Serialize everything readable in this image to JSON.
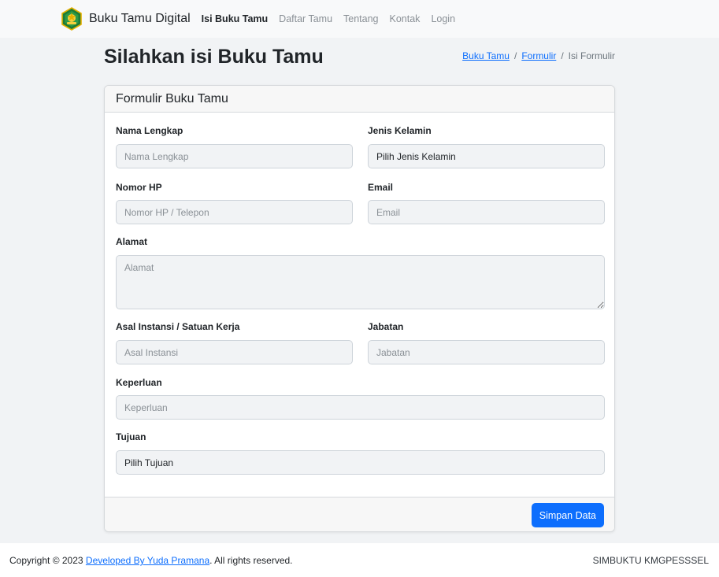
{
  "navbar": {
    "brand": "Buku Tamu Digital",
    "links": [
      "Isi Buku Tamu",
      "Daftar Tamu",
      "Tentang",
      "Kontak",
      "Login"
    ]
  },
  "page": {
    "title_prefix": "Silahkan isi ",
    "title_bold": "Buku Tamu"
  },
  "breadcrumb": {
    "items": [
      "Buku Tamu",
      "Formulir",
      "Isi Formulir"
    ],
    "separator": "/"
  },
  "form": {
    "header": "Formulir Buku Tamu",
    "nama": {
      "label": "Nama Lengkap",
      "placeholder": "Nama Lengkap",
      "value": ""
    },
    "jenis_kelamin": {
      "label": "Jenis Kelamin",
      "selected": "Pilih Jenis Kelamin"
    },
    "nomor_hp": {
      "label": "Nomor HP",
      "placeholder": "Nomor HP / Telepon",
      "value": ""
    },
    "email": {
      "label": "Email",
      "placeholder": "Email",
      "value": ""
    },
    "alamat": {
      "label": "Alamat",
      "placeholder": "Alamat",
      "value": ""
    },
    "instansi": {
      "label": "Asal Instansi / Satuan Kerja",
      "placeholder": "Asal Instansi",
      "value": ""
    },
    "jabatan": {
      "label": "Jabatan",
      "placeholder": "Jabatan",
      "value": ""
    },
    "keperluan": {
      "label": "Keperluan",
      "placeholder": "Keperluan",
      "value": ""
    },
    "tujuan": {
      "label": "Tujuan",
      "selected": "Pilih Tujuan"
    },
    "submit_label": "Simpan Data"
  },
  "footer": {
    "copyright_prefix": "Copyright © 2023 ",
    "developer_link": "Developed By Yuda Pramana",
    "copyright_suffix": ". All rights reserved.",
    "right_text": "SIMBUKTU KMGPESSSEL"
  },
  "colors": {
    "primary": "#0d6efd",
    "navbar_bg": "#f8f9fa",
    "page_bg": "#f1f3f5",
    "logo_green": "#1e7b34",
    "logo_gold": "#e5b000"
  },
  "icons": {
    "brand_logo": "ministry-emblem-icon"
  }
}
